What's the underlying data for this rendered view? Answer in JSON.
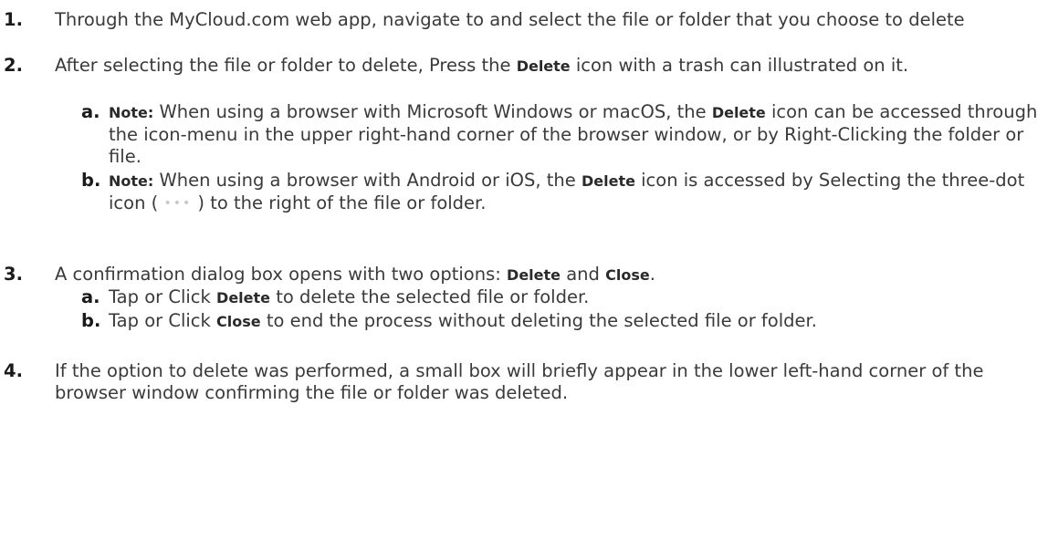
{
  "steps": [
    {
      "num": "1.",
      "text": "Through the MyCloud.com web app, navigate to and select the file or folder that you choose to delete"
    },
    {
      "num": "2.",
      "pre": "After selecting the file or folder to delete, Press the ",
      "bold": "Delete",
      "post": " icon with a trash can illustrated on it.",
      "subs": [
        {
          "letter": "a.",
          "note": "Note:",
          "pre": " When using a browser with Microsoft Windows or macOS, the ",
          "bold": "Delete",
          "post": " icon can be accessed through the icon-menu in the upper right-hand corner of the browser window, or by Right-Clicking the folder or file."
        },
        {
          "letter": "b.",
          "note": "Note:",
          "pre": " When using a browser with Android or iOS, the ",
          "bold": "Delete",
          "mid": " icon is accessed by Selecting the three-dot icon ( ",
          "dots": "•••",
          "post": " ) to the right of the file or folder."
        }
      ]
    },
    {
      "num": "3.",
      "pre": "A confirmation dialog box opens with two options: ",
      "bold1": "Delete",
      "mid": " and ",
      "bold2": "Close",
      "post": ".",
      "subs": [
        {
          "letter": "a.",
          "pre": "Tap or Click ",
          "bold": "Delete",
          "post": " to delete the selected file or folder."
        },
        {
          "letter": "b.",
          "pre": "Tap or Click ",
          "bold": "Close",
          "post": " to end the process without deleting the selected file or folder."
        }
      ]
    },
    {
      "num": "4.",
      "text": "If the option to delete was performed, a small box will briefly appear in the lower left-hand corner of the browser window confirming the file or folder was deleted."
    }
  ]
}
